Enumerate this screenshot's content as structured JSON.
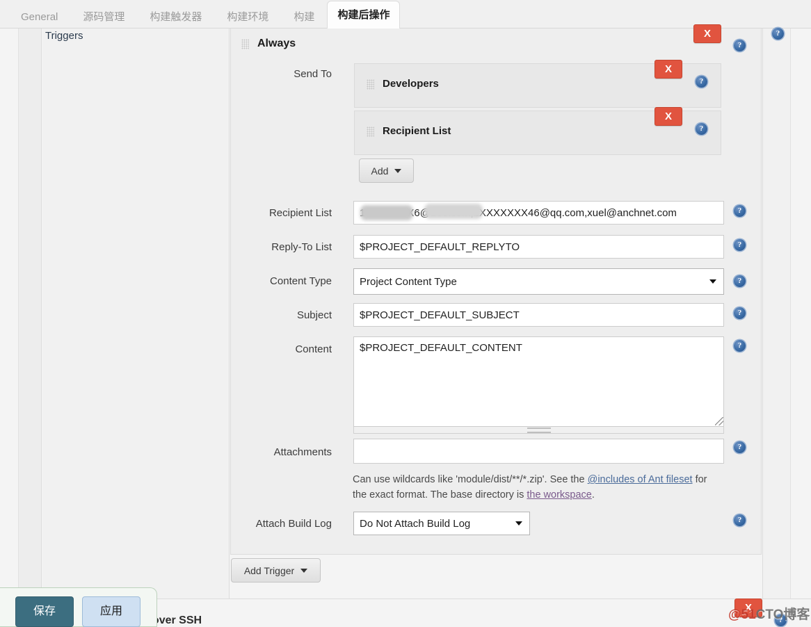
{
  "tabs": [
    {
      "label": "General",
      "active": false
    },
    {
      "label": "源码管理",
      "active": false
    },
    {
      "label": "构建触发器",
      "active": false
    },
    {
      "label": "构建环境",
      "active": false
    },
    {
      "label": "构建",
      "active": false
    },
    {
      "label": "构建后操作",
      "active": true
    }
  ],
  "sidebar": {
    "items": [
      {
        "label": "Triggers"
      }
    ]
  },
  "trigger": {
    "title": "Always",
    "delete_label": "X",
    "help_label": "?",
    "send_to_label": "Send To",
    "recipients": [
      {
        "title": "Developers",
        "delete_label": "X",
        "help_label": "?"
      },
      {
        "title": "Recipient List",
        "delete_label": "X",
        "help_label": "?"
      }
    ],
    "add_button": "Add"
  },
  "fields": {
    "recipient_list": {
      "label": "Recipient List",
      "value": "1XXXXXXX6@163.com,2XXXXXXX46@qq.com,xuel@anchnet.com",
      "placeholder": ""
    },
    "reply_to_list": {
      "label": "Reply-To List",
      "value": "$PROJECT_DEFAULT_REPLYTO",
      "placeholder": ""
    },
    "content_type": {
      "label": "Content Type",
      "value": "Project Content Type",
      "options": [
        "Project Content Type"
      ]
    },
    "subject": {
      "label": "Subject",
      "value": "$PROJECT_DEFAULT_SUBJECT",
      "placeholder": ""
    },
    "content": {
      "label": "Content",
      "value": "$PROJECT_DEFAULT_CONTENT",
      "placeholder": ""
    },
    "attachments": {
      "label": "Attachments",
      "value": "",
      "placeholder": "",
      "help_text_1": "Can use wildcards like 'module/dist/**/*.zip'. See the ",
      "help_link_1": "@includes of Ant fileset",
      "help_text_2": " for the exact format. The base directory is ",
      "help_link_2": "the workspace",
      "help_text_3": "."
    },
    "attach_build_log": {
      "label": "Attach Build Log",
      "value": "Do Not Attach Build Log",
      "options": [
        "Do Not Attach Build Log"
      ]
    }
  },
  "add_trigger_button": "Add Trigger",
  "bottom_section": {
    "title": "Send build artifacts over SSH",
    "delete_label": "X",
    "help_label": "?"
  },
  "footer": {
    "save_label": "保存",
    "apply_label": "应用"
  },
  "watermark": {
    "prefix": "@51",
    "suffix": "CTO博客"
  }
}
